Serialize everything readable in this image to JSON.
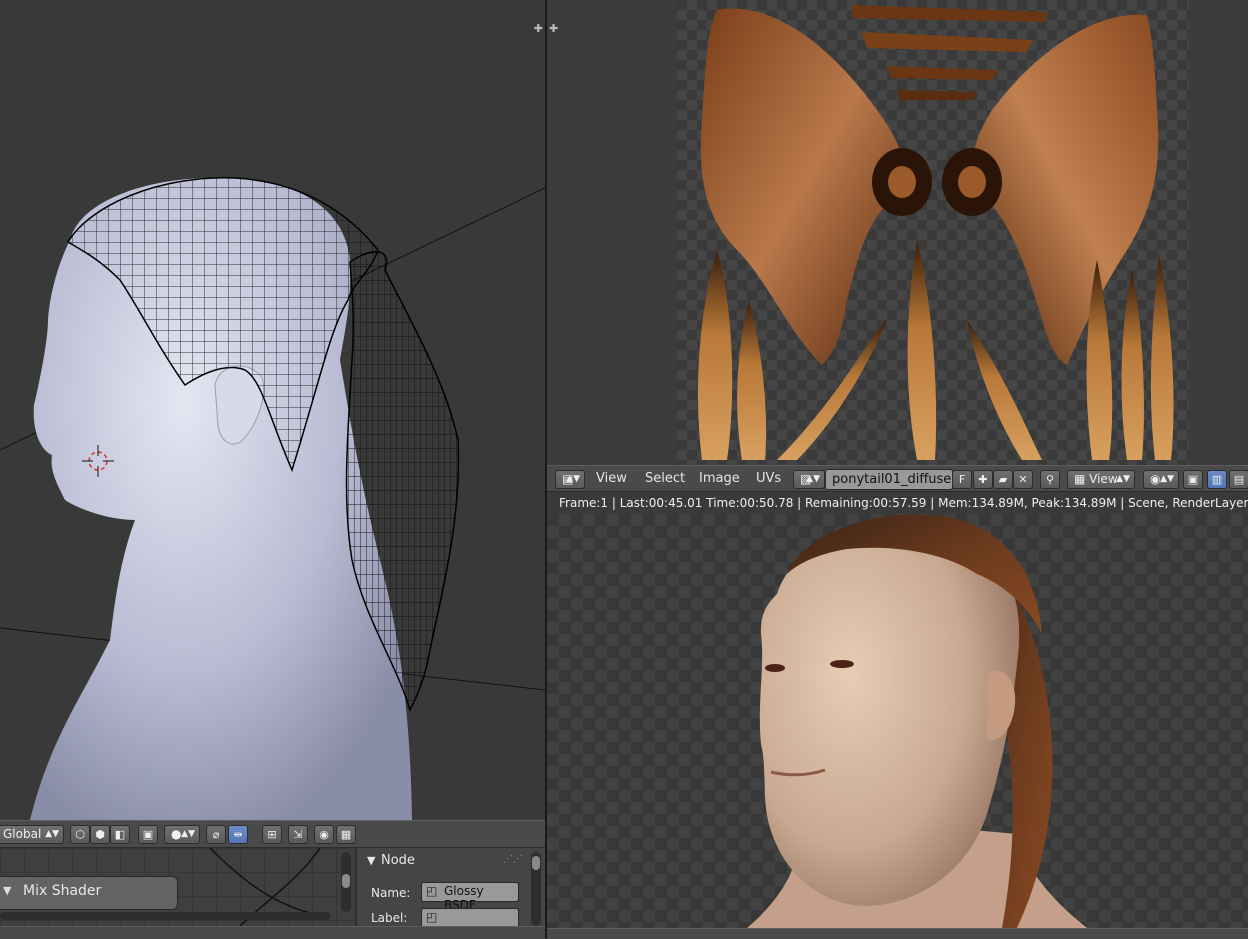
{
  "uv_editor": {
    "header": {
      "menu": [
        "View",
        "Select",
        "Image",
        "UVs"
      ],
      "image_name": "ponytail01_diffuse...",
      "fake_user": "F",
      "view_mode": "View"
    }
  },
  "render_view": {
    "info": "Frame:1 | Last:00:45.01 Time:00:50.78 | Remaining:00:57.59 | Mem:134.89M, Peak:134.89M | Scene, RenderLayer | Path Trac"
  },
  "viewport_header": {
    "orientation": "Global"
  },
  "node_editor": {
    "node_title": "Mix Shader"
  },
  "node_panel": {
    "title": "Node",
    "name_label": "Name:",
    "name_value": "Glossy BSDF",
    "label_label": "Label:",
    "label_value": ""
  },
  "colors": {
    "selection_blue": "#5276b8",
    "mesh_surface": "#c0c2d8",
    "wireframe": "#000000",
    "hair_texture": "#a0602c",
    "skin_render": "#d8bca4"
  },
  "icons": [
    "editor-type-icon",
    "add-image-icon",
    "open-image-icon",
    "close-icon",
    "pin-icon",
    "draw-channels-icon",
    "sampling-icon",
    "render-slot-icon",
    "cursor-3d-icon",
    "vertex-select-icon",
    "edge-select-icon",
    "face-select-icon",
    "pivot-icon",
    "snap-icon",
    "proportional-icon",
    "render-icon",
    "camera-icon"
  ]
}
